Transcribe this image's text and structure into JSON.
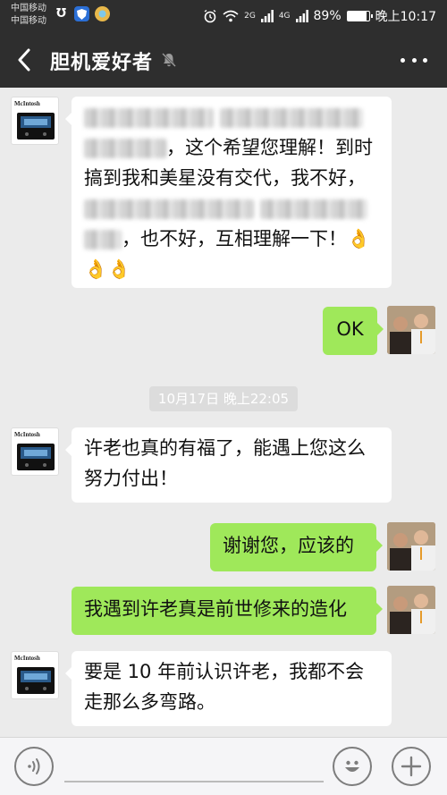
{
  "status_bar": {
    "carrier1": "中国移动",
    "carrier2": "中国移动",
    "net_2g": "2G",
    "net_4g": "4G",
    "battery_text": "89%",
    "battery_level": 0.89,
    "time": "晚上10:17"
  },
  "header": {
    "title": "胆机爱好者"
  },
  "messages": [
    {
      "side": "left",
      "avatar": "mcintosh-amplifier",
      "line1": "",
      "line2_text": "，这个希望您理解！到时",
      "line3": "搞到我和美星没有交代，我不好，",
      "line5_text": "，也不好，互相理解一下！",
      "emoji": "👌"
    },
    {
      "side": "right",
      "text": "OK"
    },
    {
      "type": "timestamp",
      "text": "10月17日 晚上22:05"
    },
    {
      "side": "left",
      "line1": "许老也真的有福了，能遇上您这么",
      "line2": "努力付出！"
    },
    {
      "side": "right",
      "text": "谢谢您，应该的"
    },
    {
      "side": "right",
      "text": "我遇到许老真是前世修来的造化"
    },
    {
      "side": "left",
      "line1": "要是 10 年前认识许老，我都不会",
      "line2": "走那么多弯路。"
    }
  ],
  "avatar_brand_text": "McIntosh",
  "colors": {
    "header_bg": "#2e2e2e",
    "chat_bg": "#ebebeb",
    "bubble_sent": "#9fe85a",
    "bubble_received": "#ffffff"
  }
}
